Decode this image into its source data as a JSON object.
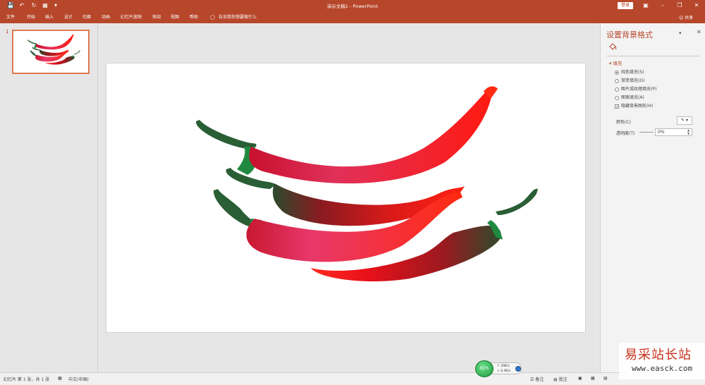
{
  "app": {
    "window_title": "演示文稿1 - PowerPoint",
    "login_label": "登录",
    "share_label": "共享"
  },
  "ribbon_tabs": [
    "文件",
    "开始",
    "插入",
    "设计",
    "切换",
    "动画",
    "幻灯片放映",
    "审阅",
    "视图",
    "帮助"
  ],
  "tell_me": "告诉我你想要做什么",
  "thumbnails": [
    {
      "number": "1"
    }
  ],
  "format_pane": {
    "title": "设置背景格式",
    "section": "填充",
    "options": [
      {
        "label": "纯色填充(S)",
        "type": "radio",
        "checked": true
      },
      {
        "label": "渐变填充(G)",
        "type": "radio",
        "checked": false
      },
      {
        "label": "图片或纹理填充(P)",
        "type": "radio",
        "checked": false
      },
      {
        "label": "图案填充(A)",
        "type": "radio",
        "checked": false
      },
      {
        "label": "隐藏背景图形(H)",
        "type": "checkbox",
        "checked": true
      }
    ],
    "color_label": "颜色(C)",
    "transparency_label": "透明度(T)",
    "transparency_value": "0%"
  },
  "status": {
    "slide_info": "幻灯片 第 1 张，共 1 张",
    "language": "中文(中国)",
    "notes": "备注",
    "comments": "批注"
  },
  "network_widget": {
    "percent": "61%",
    "up": "20K/s",
    "down": "6.4K/s"
  },
  "watermark": {
    "text": "易采站长站",
    "url": "www.easck.com"
  },
  "colors": {
    "accent": "#b7472a",
    "pepper_red": "#e8141a",
    "stem_green": "#2a6b3a"
  }
}
